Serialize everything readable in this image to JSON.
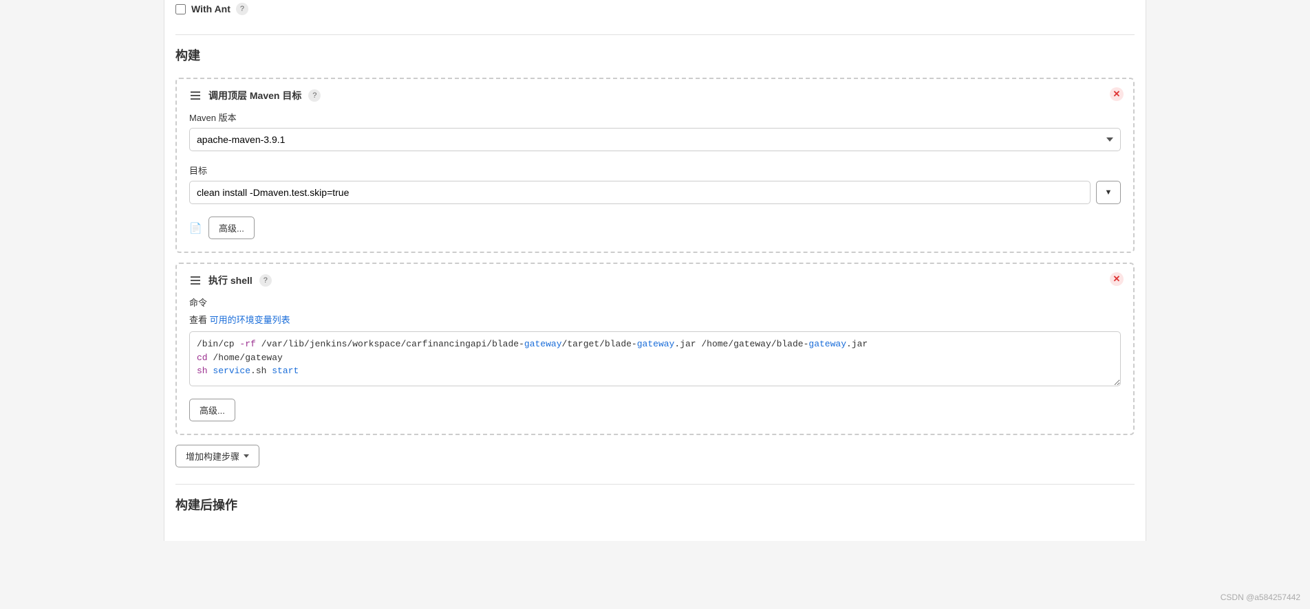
{
  "top": {
    "with_ant_label": "With Ant"
  },
  "build": {
    "section_title": "构建",
    "maven_step": {
      "title": "调用顶层 Maven 目标",
      "version_label": "Maven 版本",
      "version_value": "apache-maven-3.9.1",
      "goal_label": "目标",
      "goal_value": "clean install -Dmaven.test.skip=true",
      "advanced_label": "高级..."
    },
    "shell_step": {
      "title": "执行 shell",
      "command_label": "命令",
      "see_text": "查看",
      "env_link": "可用的环境变量列表",
      "script_tokens": [
        {
          "t": "/bin/cp ",
          "c": ""
        },
        {
          "t": "-rf",
          "c": "kw"
        },
        {
          "t": " /var/lib/jenkins/workspace/carfinancingapi/blade-",
          "c": ""
        },
        {
          "t": "gateway",
          "c": "cmd"
        },
        {
          "t": "/target/blade-",
          "c": ""
        },
        {
          "t": "gateway",
          "c": "cmd"
        },
        {
          "t": ".jar /home/gateway/blade-",
          "c": ""
        },
        {
          "t": "gateway",
          "c": "cmd"
        },
        {
          "t": ".jar\n",
          "c": ""
        },
        {
          "t": "cd",
          "c": "kw"
        },
        {
          "t": " /home/gateway\n",
          "c": ""
        },
        {
          "t": "sh",
          "c": "kw"
        },
        {
          "t": " ",
          "c": ""
        },
        {
          "t": "service",
          "c": "cmd"
        },
        {
          "t": ".sh ",
          "c": ""
        },
        {
          "t": "start",
          "c": "cmd"
        }
      ],
      "advanced_label": "高级..."
    },
    "add_step_label": "增加构建步骤"
  },
  "post_build": {
    "section_title": "构建后操作"
  },
  "watermark": "CSDN @a584257442"
}
